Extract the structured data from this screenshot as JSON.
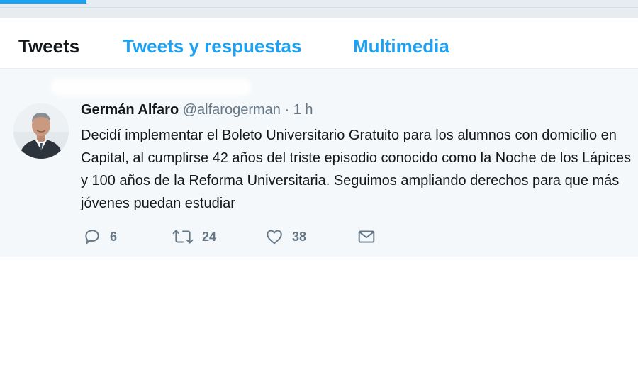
{
  "load_progress": 0.135,
  "accent_color": "#1da1f2",
  "tabs": [
    {
      "label": "Tweets",
      "active": true
    },
    {
      "label": "Tweets y respuestas",
      "active": false
    },
    {
      "label": "Multimedia",
      "active": false
    }
  ],
  "tweet": {
    "author": "Germán Alfaro",
    "handle": "@alfarogerman",
    "separator": "·",
    "time": "1 h",
    "text": "Decidí implementar el Boleto Universitario Gratuito para los alumnos con domicilio en Capital, al cumplirse 42 años del triste episodio conocido como la Noche de los Lápices y 100 años de la Reforma Universitaria. Seguimos ampliando derechos para que más jóvenes puedan estudiar",
    "actions": {
      "reply_count": "6",
      "retweet_count": "24",
      "like_count": "38"
    },
    "icons": [
      "reply-icon",
      "retweet-icon",
      "heart-icon",
      "envelope-icon"
    ]
  }
}
